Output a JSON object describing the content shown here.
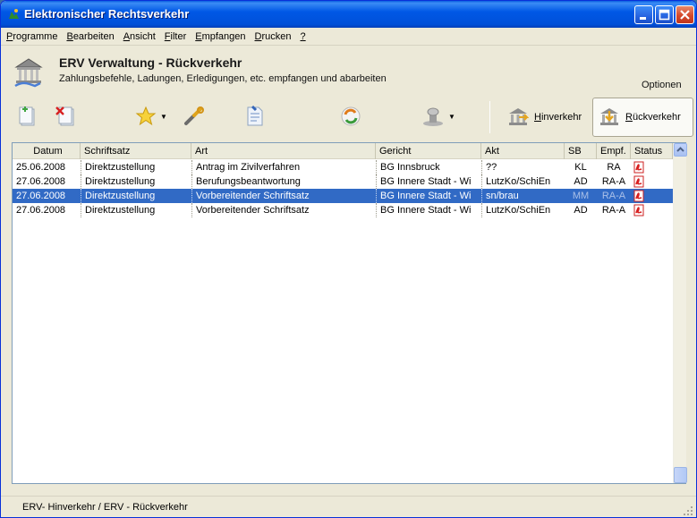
{
  "window": {
    "title": "Elektronischer Rechtsverkehr"
  },
  "menu": [
    {
      "mn": "P",
      "rest": "rogramme"
    },
    {
      "mn": "B",
      "rest": "earbeiten"
    },
    {
      "mn": "A",
      "rest": "nsicht"
    },
    {
      "mn": "F",
      "rest": "ilter"
    },
    {
      "mn": "E",
      "rest": "mpfangen"
    },
    {
      "mn": "D",
      "rest": "rucken"
    },
    {
      "mn": "?",
      "rest": ""
    }
  ],
  "header": {
    "title": "ERV Verwaltung - Rückverkehr",
    "subtitle": "Zahlungsbefehle, Ladungen, Erledigungen, etc. empfangen und abarbeiten",
    "options_label": "Optionen"
  },
  "toolbar": {
    "nav_hin_mn": "H",
    "nav_hin_rest": "inverkehr",
    "nav_rueck_mn": "R",
    "nav_rueck_rest": "ückverkehr"
  },
  "table": {
    "columns": [
      "Datum",
      "Schriftsatz",
      "Art",
      "Gericht",
      "Akt",
      "SB",
      "Empf.",
      "Status"
    ],
    "rows": [
      {
        "datum": "25.06.2008",
        "schriftsatz": "Direktzustellung",
        "art": "Antrag im Zivilverfahren",
        "gericht": "BG Innsbruck",
        "akt": "??",
        "sb": "KL",
        "empf": "RA",
        "status_icon": "pdf-icon",
        "selected": false
      },
      {
        "datum": "27.06.2008",
        "schriftsatz": "Direktzustellung",
        "art": "Berufungsbeantwortung",
        "gericht": "BG Innere Stadt - Wi",
        "akt": "LutzKo/SchiEn",
        "sb": "AD",
        "empf": "RA-A",
        "status_icon": "pdf-icon",
        "selected": false
      },
      {
        "datum": "27.06.2008",
        "schriftsatz": "Direktzustellung",
        "art": "Vorbereitender Schriftsatz",
        "gericht": "BG Innere Stadt - Wi",
        "akt": "sn/brau",
        "sb": "MM",
        "empf": "RA-A",
        "status_icon": "pdf-icon",
        "selected": true
      },
      {
        "datum": "27.06.2008",
        "schriftsatz": "Direktzustellung",
        "art": "Vorbereitender Schriftsatz",
        "gericht": "BG Innere Stadt - Wi",
        "akt": "LutzKo/SchiEn",
        "sb": "AD",
        "empf": "RA-A",
        "status_icon": "pdf-icon",
        "selected": false
      }
    ]
  },
  "statusbar": {
    "text": "ERV- Hinverkehr / ERV - Rückverkehr"
  },
  "colors": {
    "selection": "#316ac5",
    "titlebar": "#0058e6",
    "pdf_red": "#d81e1e"
  }
}
